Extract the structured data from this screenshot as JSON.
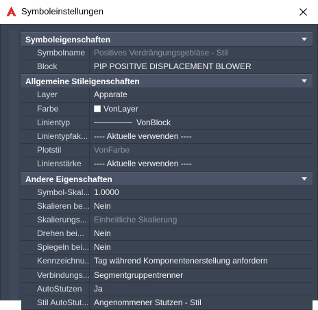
{
  "window": {
    "title": "Symboleinstellungen"
  },
  "icons": {
    "app": "autocad-a-icon",
    "close": "close-icon",
    "collapse": "chevron-down-icon"
  },
  "colors": {
    "panel_bg": "#3b4453",
    "section_bg": "#4a5466",
    "app_icon": "#d9251c",
    "value_text": "#f2f2f2",
    "dim_text": "#8d96a3"
  },
  "sections": [
    {
      "title": "Symboleigenschaften",
      "rows": [
        {
          "label": "Symbolname",
          "value": "Positives Verdrängungsgebläse - Stil",
          "dim": true
        },
        {
          "label": "Block",
          "value": "PIP POSITIVE DISPLACEMENT BLOWER",
          "dim": false
        }
      ]
    },
    {
      "title": "Allgemeine Stileigenschaften",
      "rows": [
        {
          "label": "Layer",
          "value": "Apparate",
          "dim": false
        },
        {
          "label": "Farbe",
          "value": "VonLayer",
          "dim": false
        },
        {
          "label": "Linientyp",
          "value": "VonBlock",
          "dim": false
        },
        {
          "label": "Linientypfak...",
          "value": "---- Aktuelle verwenden ----",
          "dim": false
        },
        {
          "label": "Plotstil",
          "value": "VonFarbe",
          "dim": true
        },
        {
          "label": "Linienstärke",
          "value": "---- Aktuelle verwenden ----",
          "dim": false
        }
      ]
    },
    {
      "title": "Andere Eigenschaften",
      "rows": [
        {
          "label": "Symbol-Skal...",
          "value": "1.0000",
          "dim": false
        },
        {
          "label": "Skalieren be...",
          "value": "Nein",
          "dim": false
        },
        {
          "label": "Skalierungs...",
          "value": "Einheitliche Skalierung",
          "dim": true
        },
        {
          "label": "Drehen bei...",
          "value": "Nein",
          "dim": false
        },
        {
          "label": "Spiegeln bei...",
          "value": "Nein",
          "dim": false
        },
        {
          "label": "Kennzeichnu...",
          "value": "Tag während Komponentenerstellung anfordern",
          "dim": false
        },
        {
          "label": "Verbindungs...",
          "value": "Segmentgruppentrenner",
          "dim": false
        },
        {
          "label": "AutoStutzen",
          "value": "Ja",
          "dim": false
        },
        {
          "label": "Stil AutoStut...",
          "value": "Angenommener Stutzen - Stil",
          "dim": false
        }
      ]
    }
  ]
}
